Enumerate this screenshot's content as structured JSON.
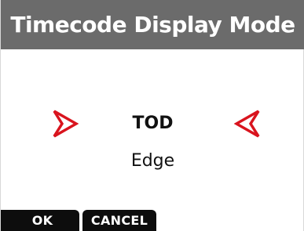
{
  "header": {
    "title": "Timecode Display Mode"
  },
  "selector": {
    "left_arrow_icon": "red-outline-arrow-right-icon",
    "right_arrow_icon": "red-outline-arrow-left-icon",
    "options": [
      {
        "label": "TOD",
        "selected": true
      },
      {
        "label": "Edge",
        "selected": false
      }
    ]
  },
  "softkeys": {
    "ok_label": "OK",
    "cancel_label": "CANCEL"
  },
  "colors": {
    "title_bar": "#6b6b6b",
    "arrow": "#d9141e",
    "softkey_bg": "#0d0d0d"
  }
}
